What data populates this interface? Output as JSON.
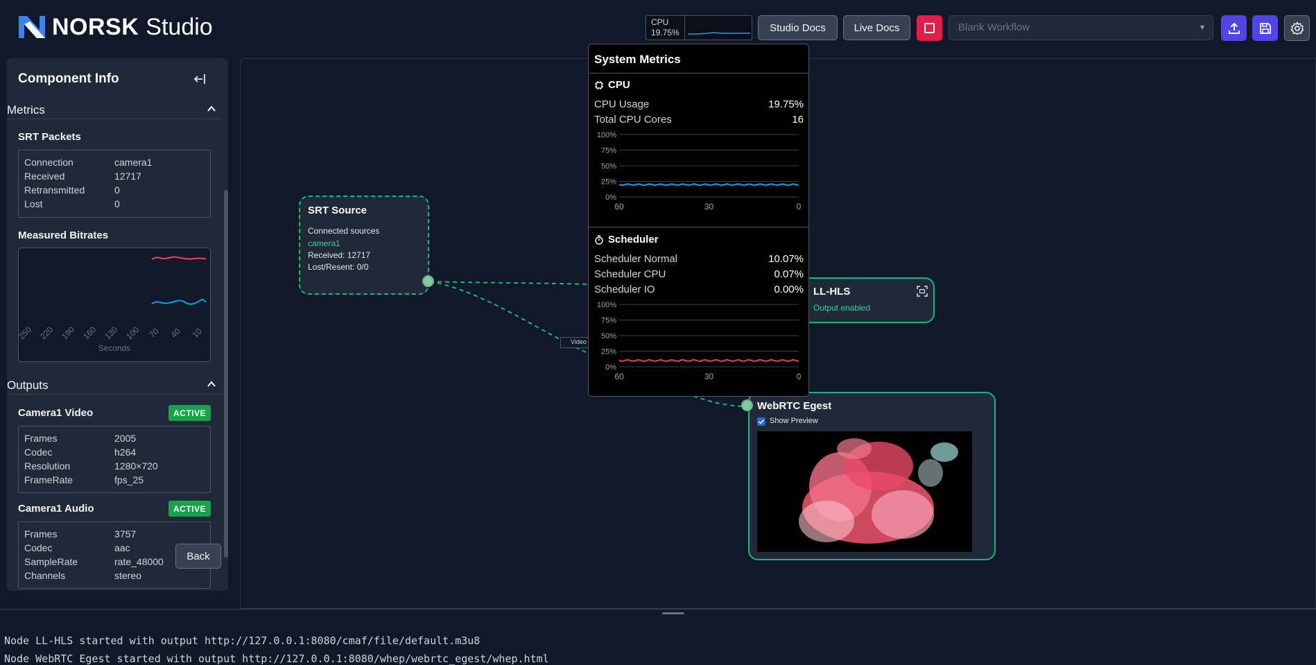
{
  "header": {
    "brand": "NORSK",
    "product": "Studio",
    "cpu_label": "CPU",
    "cpu_value": "19.75%",
    "studio_docs": "Studio Docs",
    "live_docs": "Live Docs",
    "workflow_placeholder": "Blank Workflow",
    "icons": [
      "stop-icon",
      "upload-icon",
      "save-icon",
      "settings-icon"
    ]
  },
  "sidebar": {
    "title": "Component Info",
    "metrics_section": "Metrics",
    "srt_packets_title": "SRT Packets",
    "srt_packets": [
      {
        "k": "Connection",
        "v": "camera1"
      },
      {
        "k": "Received",
        "v": "12717"
      },
      {
        "k": "Retransmitted",
        "v": "0"
      },
      {
        "k": "Lost",
        "v": "0"
      }
    ],
    "bitrates_title": "Measured Bitrates",
    "bitrate_ticks": [
      "250",
      "220",
      "190",
      "160",
      "130",
      "100",
      "70",
      "40",
      "10"
    ],
    "bitrate_xlabel": "Seconds",
    "outputs_section": "Outputs",
    "video_title": "Camera1 Video",
    "video_badge": "ACTIVE",
    "video_stats": [
      {
        "k": "Frames",
        "v": "2005"
      },
      {
        "k": "Codec",
        "v": "h264"
      },
      {
        "k": "Resolution",
        "v": "1280×720"
      },
      {
        "k": "FrameRate",
        "v": "fps_25"
      }
    ],
    "audio_title": "Camera1 Audio",
    "audio_badge": "ACTIVE",
    "audio_stats": [
      {
        "k": "Frames",
        "v": "3757"
      },
      {
        "k": "Codec",
        "v": "aac"
      },
      {
        "k": "SampleRate",
        "v": "rate_48000"
      },
      {
        "k": "Channels",
        "v": "stereo"
      }
    ],
    "back": "Back"
  },
  "canvas": {
    "srt_node": {
      "title": "SRT Source",
      "line1": "Connected sources",
      "line2": "camera1",
      "line3": "Received: 12717",
      "line4": "Lost/Resent: 0/0"
    },
    "edge_tag": "Video",
    "hls_node": {
      "title": "LL-HLS",
      "status": "Output enabled"
    },
    "webrtc_node": {
      "title": "WebRTC Egest",
      "preview_label": "Show Preview",
      "preview_checked": true
    }
  },
  "metrics_popover": {
    "title": "System Metrics",
    "cpu_title": "CPU",
    "cpu_rows": [
      {
        "k": "CPU Usage",
        "v": "19.75%"
      },
      {
        "k": "Total CPU Cores",
        "v": "16"
      }
    ],
    "sched_title": "Scheduler",
    "sched_rows": [
      {
        "k": "Scheduler Normal",
        "v": "10.07%"
      },
      {
        "k": "Scheduler CPU",
        "v": "0.07%"
      },
      {
        "k": "Scheduler IO",
        "v": "0.00%"
      }
    ],
    "y_ticks": [
      "100%",
      "75%",
      "50%",
      "25%",
      "0%"
    ],
    "x_ticks": [
      "60",
      "30",
      "0"
    ]
  },
  "chart_data": [
    {
      "type": "line",
      "x": [
        60,
        0
      ],
      "series": [
        {
          "values": [
            19.75
          ]
        }
      ],
      "ylim": [
        0,
        100
      ],
      "ylabel": "",
      "xlabel": ""
    },
    {
      "type": "line",
      "x": [
        60,
        0
      ],
      "series": [
        {
          "values": [
            10.07
          ]
        }
      ],
      "ylim": [
        0,
        100
      ],
      "ylabel": "",
      "xlabel": ""
    }
  ],
  "console": {
    "lines": [
      "Node LL-HLS started with output http://127.0.0.1:8080/cmaf/file/default.m3u8",
      "Node WebRTC Egest started with output http://127.0.0.1:8080/whep/webrtc_egest/whep.html"
    ]
  },
  "colors": {
    "accent_green": "#10b981",
    "badge_green": "#16a34a",
    "stop_red": "#e11d48",
    "primary_blue": "#4f46e5",
    "cpu_line": "#0ea5e9",
    "sched_line": "#f43f5e"
  }
}
